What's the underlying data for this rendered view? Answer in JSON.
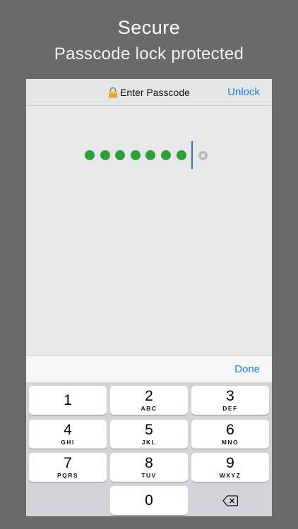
{
  "promo": {
    "title": "Secure",
    "subtitle": "Passcode lock protected"
  },
  "navbar": {
    "lock_icon": "lock-icon",
    "title": "Enter Passcode",
    "unlock_label": "Unlock"
  },
  "passcode": {
    "entered_digits": 7,
    "dot_color": "#2ea03a",
    "caret_color": "#3d6ddc",
    "clear_icon": "clear-circle-icon"
  },
  "accessory": {
    "done_label": "Done"
  },
  "keypad": {
    "keys": [
      {
        "num": "1",
        "letters": ""
      },
      {
        "num": "2",
        "letters": "ABC"
      },
      {
        "num": "3",
        "letters": "DEF"
      },
      {
        "num": "4",
        "letters": "GHI"
      },
      {
        "num": "5",
        "letters": "JKL"
      },
      {
        "num": "6",
        "letters": "MNO"
      },
      {
        "num": "7",
        "letters": "PQRS"
      },
      {
        "num": "8",
        "letters": "TUV"
      },
      {
        "num": "9",
        "letters": "WXYZ"
      },
      {
        "num": "0",
        "letters": ""
      }
    ],
    "delete_icon": "backspace-icon"
  },
  "colors": {
    "accent": "#1a7ff0",
    "background": "#6a6a6a"
  }
}
